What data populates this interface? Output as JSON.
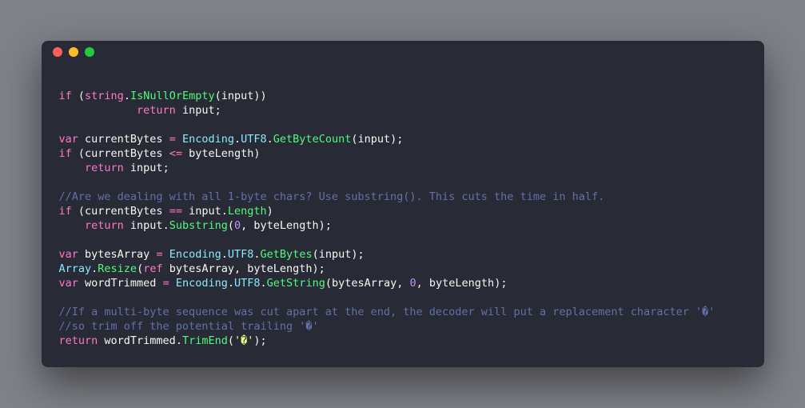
{
  "tokens": [
    {
      "c": "id",
      "t": "\n"
    },
    {
      "c": "kw",
      "t": "if"
    },
    {
      "c": "id",
      "t": " ("
    },
    {
      "c": "kw",
      "t": "string"
    },
    {
      "c": "id",
      "t": "."
    },
    {
      "c": "mem",
      "t": "IsNullOrEmpty"
    },
    {
      "c": "id",
      "t": "("
    },
    {
      "c": "id",
      "t": "input"
    },
    {
      "c": "id",
      "t": "))"
    },
    {
      "c": "id",
      "t": "\n"
    },
    {
      "c": "id",
      "t": "            "
    },
    {
      "c": "kw",
      "t": "return"
    },
    {
      "c": "id",
      "t": " input;"
    },
    {
      "c": "id",
      "t": "\n"
    },
    {
      "c": "id",
      "t": "\n"
    },
    {
      "c": "kw",
      "t": "var"
    },
    {
      "c": "id",
      "t": " currentBytes "
    },
    {
      "c": "kw",
      "t": "="
    },
    {
      "c": "id",
      "t": " "
    },
    {
      "c": "type",
      "t": "Encoding"
    },
    {
      "c": "id",
      "t": "."
    },
    {
      "c": "type",
      "t": "UTF8"
    },
    {
      "c": "id",
      "t": "."
    },
    {
      "c": "mem",
      "t": "GetByteCount"
    },
    {
      "c": "id",
      "t": "("
    },
    {
      "c": "id",
      "t": "input"
    },
    {
      "c": "id",
      "t": ");"
    },
    {
      "c": "id",
      "t": "\n"
    },
    {
      "c": "kw",
      "t": "if"
    },
    {
      "c": "id",
      "t": " (currentBytes "
    },
    {
      "c": "kw",
      "t": "<="
    },
    {
      "c": "id",
      "t": " byteLength)"
    },
    {
      "c": "id",
      "t": "\n"
    },
    {
      "c": "id",
      "t": "    "
    },
    {
      "c": "kw",
      "t": "return"
    },
    {
      "c": "id",
      "t": " input;"
    },
    {
      "c": "id",
      "t": "\n"
    },
    {
      "c": "id",
      "t": "\n"
    },
    {
      "c": "cmt",
      "t": "//Are we dealing with all 1-byte chars? Use substring(). This cuts the time in half."
    },
    {
      "c": "id",
      "t": "\n"
    },
    {
      "c": "kw",
      "t": "if"
    },
    {
      "c": "id",
      "t": " (currentBytes "
    },
    {
      "c": "kw",
      "t": "=="
    },
    {
      "c": "id",
      "t": " input."
    },
    {
      "c": "mem",
      "t": "Length"
    },
    {
      "c": "id",
      "t": ")"
    },
    {
      "c": "id",
      "t": "\n"
    },
    {
      "c": "id",
      "t": "    "
    },
    {
      "c": "kw",
      "t": "return"
    },
    {
      "c": "id",
      "t": " input."
    },
    {
      "c": "mem",
      "t": "Substring"
    },
    {
      "c": "id",
      "t": "("
    },
    {
      "c": "num",
      "t": "0"
    },
    {
      "c": "id",
      "t": ", byteLength);"
    },
    {
      "c": "id",
      "t": "\n"
    },
    {
      "c": "id",
      "t": "\n"
    },
    {
      "c": "kw",
      "t": "var"
    },
    {
      "c": "id",
      "t": " bytesArray "
    },
    {
      "c": "kw",
      "t": "="
    },
    {
      "c": "id",
      "t": " "
    },
    {
      "c": "type",
      "t": "Encoding"
    },
    {
      "c": "id",
      "t": "."
    },
    {
      "c": "type",
      "t": "UTF8"
    },
    {
      "c": "id",
      "t": "."
    },
    {
      "c": "mem",
      "t": "GetBytes"
    },
    {
      "c": "id",
      "t": "("
    },
    {
      "c": "id",
      "t": "input"
    },
    {
      "c": "id",
      "t": ");"
    },
    {
      "c": "id",
      "t": "\n"
    },
    {
      "c": "type",
      "t": "Array"
    },
    {
      "c": "id",
      "t": "."
    },
    {
      "c": "mem",
      "t": "Resize"
    },
    {
      "c": "id",
      "t": "("
    },
    {
      "c": "kw",
      "t": "ref"
    },
    {
      "c": "id",
      "t": " bytesArray, byteLength);"
    },
    {
      "c": "id",
      "t": "\n"
    },
    {
      "c": "kw",
      "t": "var"
    },
    {
      "c": "id",
      "t": " wordTrimmed "
    },
    {
      "c": "kw",
      "t": "="
    },
    {
      "c": "id",
      "t": " "
    },
    {
      "c": "type",
      "t": "Encoding"
    },
    {
      "c": "id",
      "t": "."
    },
    {
      "c": "type",
      "t": "UTF8"
    },
    {
      "c": "id",
      "t": "."
    },
    {
      "c": "mem",
      "t": "GetString"
    },
    {
      "c": "id",
      "t": "("
    },
    {
      "c": "id",
      "t": "bytesArray, "
    },
    {
      "c": "num",
      "t": "0"
    },
    {
      "c": "id",
      "t": ", byteLength);"
    },
    {
      "c": "id",
      "t": "\n"
    },
    {
      "c": "id",
      "t": "\n"
    },
    {
      "c": "cmt",
      "t": "//If a multi-byte sequence was cut apart at the end, the decoder will put a replacement character '�'"
    },
    {
      "c": "id",
      "t": "\n"
    },
    {
      "c": "cmt",
      "t": "//so trim off the potential trailing '�'"
    },
    {
      "c": "id",
      "t": "\n"
    },
    {
      "c": "kw",
      "t": "return"
    },
    {
      "c": "id",
      "t": " wordTrimmed."
    },
    {
      "c": "mem",
      "t": "TrimEnd"
    },
    {
      "c": "id",
      "t": "("
    },
    {
      "c": "str",
      "t": "'�'"
    },
    {
      "c": "id",
      "t": ");"
    }
  ]
}
